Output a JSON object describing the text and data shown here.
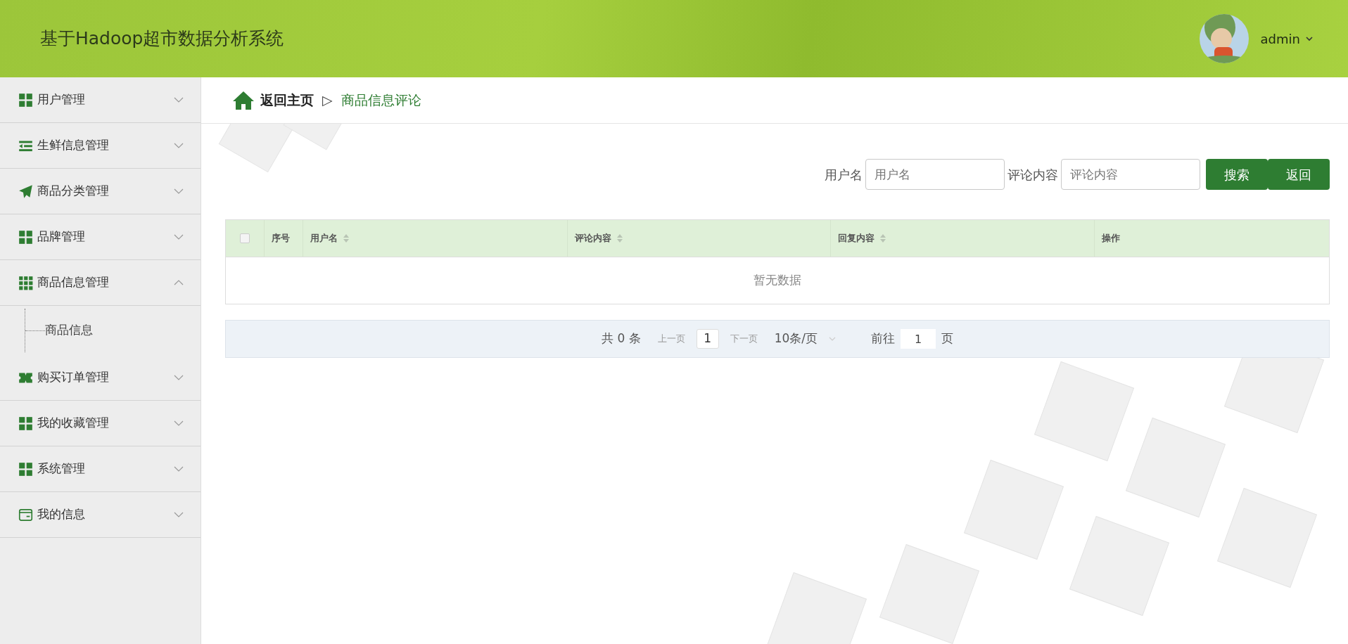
{
  "header": {
    "title": "基于Hadoop超市数据分析系统",
    "user": "admin"
  },
  "sidebar": {
    "items": [
      {
        "label": "用户管理",
        "kind": "grid",
        "expanded": false
      },
      {
        "label": "生鲜信息管理",
        "kind": "list",
        "expanded": false
      },
      {
        "label": "商品分类管理",
        "kind": "plane",
        "expanded": false
      },
      {
        "label": "品牌管理",
        "kind": "grid",
        "expanded": false
      },
      {
        "label": "商品信息管理",
        "kind": "grid9",
        "expanded": true,
        "children": [
          {
            "label": "商品信息"
          }
        ]
      },
      {
        "label": "购买订单管理",
        "kind": "ticket",
        "expanded": false
      },
      {
        "label": "我的收藏管理",
        "kind": "grid",
        "expanded": false
      },
      {
        "label": "系统管理",
        "kind": "grid",
        "expanded": false
      },
      {
        "label": "我的信息",
        "kind": "card",
        "expanded": false
      }
    ]
  },
  "breadcrumb": {
    "home": "返回主页",
    "separator": "▷",
    "current": "商品信息评论"
  },
  "search": {
    "fields": [
      {
        "label": "用户名",
        "placeholder": "用户名"
      },
      {
        "label": "评论内容",
        "placeholder": "评论内容"
      }
    ],
    "buttons": [
      "搜索",
      "返回"
    ]
  },
  "table": {
    "select_all_checked": false,
    "columns": [
      {
        "label": "序号",
        "sortable": false
      },
      {
        "label": "用户名",
        "sortable": true
      },
      {
        "label": "评论内容",
        "sortable": true
      },
      {
        "label": "回复内容",
        "sortable": true
      },
      {
        "label": "操作",
        "sortable": false
      }
    ],
    "empty_text": "暂无数据"
  },
  "pagination": {
    "total": "共 0 条",
    "prev": "上一页",
    "page": "1",
    "next": "下一页",
    "page_size": "10条/页",
    "goto_label": "前往",
    "goto_value": "1",
    "goto_suffix": "页"
  }
}
